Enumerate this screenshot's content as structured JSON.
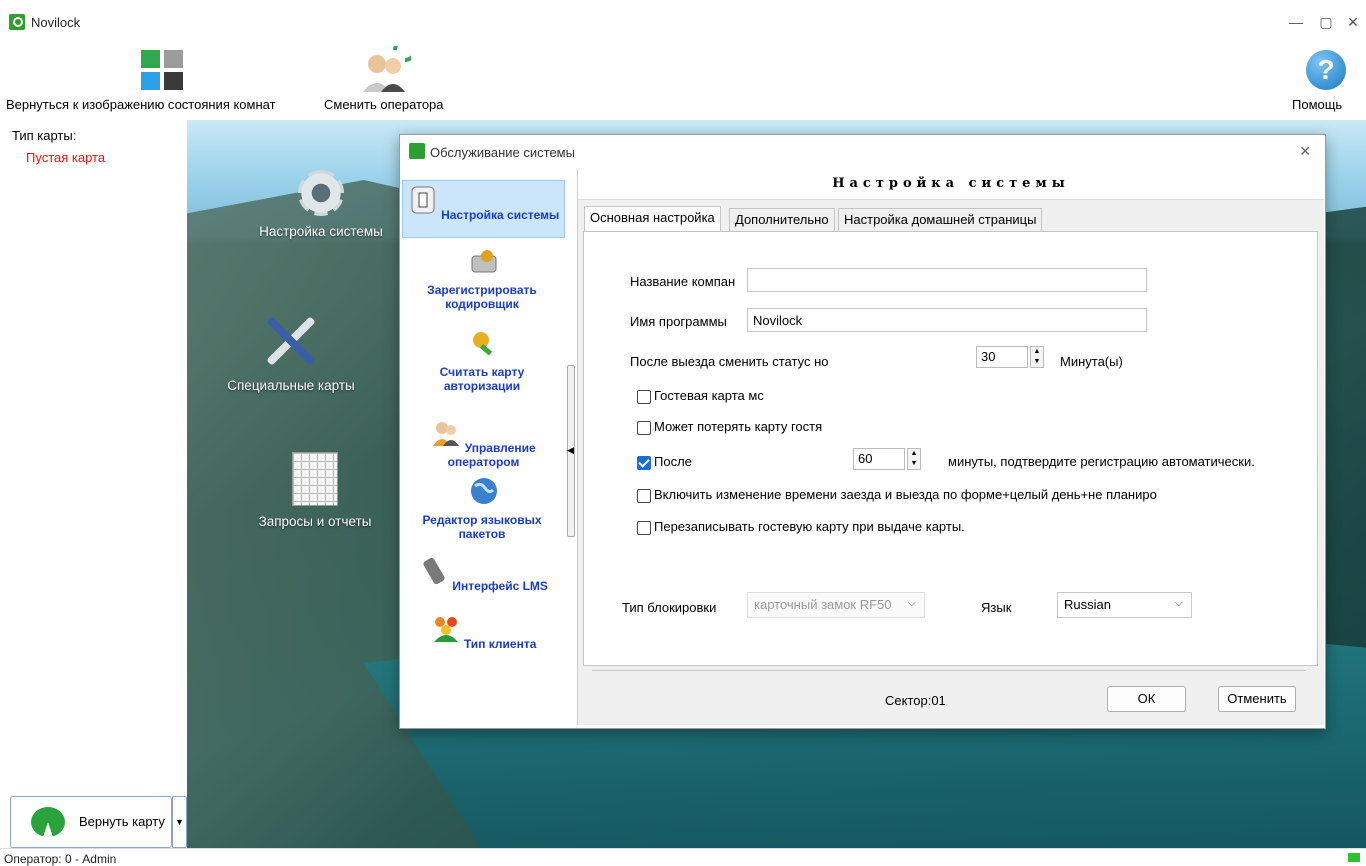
{
  "window": {
    "title": "Novilock",
    "minimize": "—",
    "maximize": "▢",
    "close": "✕"
  },
  "toolbar": {
    "back_to_rooms": "Вернуться к изображению состояния комнат",
    "change_operator": "Сменить оператора",
    "help": "Помощь",
    "help_glyph": "?"
  },
  "left_panel": {
    "card_type_label": "Тип карты:",
    "card_type_value": "Пустая карта",
    "return_card": "Вернуть карту",
    "dropdown_arrow": "▼"
  },
  "desktop": {
    "items": [
      {
        "label": "Настройка системы",
        "icon": "gear-icon"
      },
      {
        "label": "Специальные карты",
        "icon": "tools-icon"
      },
      {
        "label": "Запросы и отчеты",
        "icon": "report-icon"
      }
    ]
  },
  "dialog": {
    "title": "Обслуживание системы",
    "close": "✕",
    "nav": [
      {
        "label": "Настройка системы",
        "icon": "switch-icon",
        "active": true
      },
      {
        "label": "Зарегистрировать кодировщик",
        "icon": "encoder-icon"
      },
      {
        "label": "Считать карту авторизации",
        "icon": "key-icon"
      },
      {
        "label": "Управление оператором",
        "icon": "operator-icon"
      },
      {
        "label": "Редактор языковых пакетов",
        "icon": "globe-icon"
      },
      {
        "label": "Интерфейс LMS",
        "icon": "usb-icon"
      },
      {
        "label": "Тип клиента",
        "icon": "group-icon"
      }
    ],
    "splitter_arrow": "◀",
    "header": "Настройка системы",
    "tabs": [
      "Основная настройка",
      "Дополнительно",
      "Настройка домашней страницы"
    ],
    "form": {
      "company_label": "Название компан",
      "company_value": "",
      "program_label": "Имя программы",
      "program_value": "Novilock",
      "checkout_label": "После выезда сменить статус но",
      "checkout_value": "30",
      "checkout_unit": "Минута(ы)",
      "guest_card_label": "Гостевая карта мс",
      "guest_card_checked": false,
      "lose_card_label": "Может потерять карту гостя",
      "lose_card_checked": false,
      "after_label": "После",
      "after_checked": true,
      "after_value": "60",
      "after_unit": "минуты, подтвердите регистрацию автоматически.",
      "enable_change_label": "Включить изменение времени заезда и выезда по форме+целый день+не планиро",
      "enable_change_checked": false,
      "overwrite_label": "Перезаписывать гостевую карту при выдаче карты.",
      "overwrite_checked": false,
      "lock_type_label": "Тип блокировки",
      "lock_type_value": "карточный замок RF50",
      "language_label": "Язык",
      "language_value": "Russian",
      "spin_up": "▲",
      "spin_down": "▼",
      "select_arrow": "⌵"
    },
    "footer": {
      "sector": "Сектор:01",
      "ok": "ОК",
      "cancel": "Отменить"
    }
  },
  "status_bar": {
    "text": "Оператор: 0 - Admin"
  }
}
